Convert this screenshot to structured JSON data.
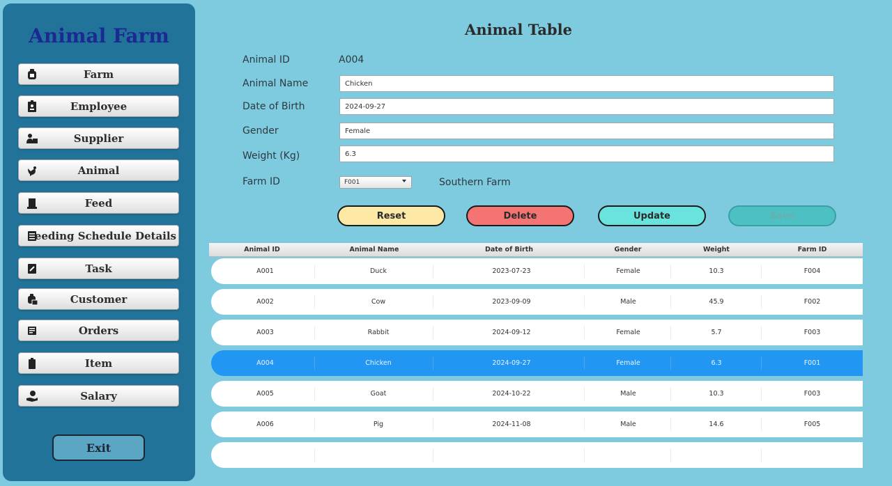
{
  "app": {
    "title": "Animal Farm"
  },
  "sidebar": {
    "items": [
      {
        "label": "Farm",
        "icon": "farm-icon"
      },
      {
        "label": "Employee",
        "icon": "id-badge-icon"
      },
      {
        "label": "Supplier",
        "icon": "supplier-icon"
      },
      {
        "label": "Animal",
        "icon": "chicken-icon"
      },
      {
        "label": "Feed",
        "icon": "feed-sack-icon"
      },
      {
        "label": "Feeding Schedule Details",
        "icon": "list-icon"
      },
      {
        "label": "Task",
        "icon": "task-icon"
      },
      {
        "label": "Customer",
        "icon": "customer-icon"
      },
      {
        "label": "Orders",
        "icon": "orders-icon"
      },
      {
        "label": "Item",
        "icon": "clipboard-icon"
      },
      {
        "label": "Salary",
        "icon": "salary-icon"
      }
    ],
    "exit_label": "Exit"
  },
  "main": {
    "title": "Animal Table",
    "form": {
      "animal_id_label": "Animal ID",
      "animal_id_value": "A004",
      "animal_name_label": "Animal Name",
      "animal_name_value": "Chicken",
      "dob_label": "Date of Birth",
      "dob_value": "2024-09-27",
      "gender_label": "Gender",
      "gender_value": "Female",
      "weight_label": "Weight (Kg)",
      "weight_value": "6.3",
      "farm_id_label": "Farm ID",
      "farm_id_selected": "F001",
      "farm_name": "Southern Farm"
    },
    "buttons": {
      "reset": "Reset",
      "delete": "Delete",
      "update": "Update",
      "save": "Save"
    },
    "colors": {
      "reset": "#fde8a6",
      "delete": "#f47373",
      "update": "#68e3dd",
      "save": "#4cc0c2",
      "selected_row": "#2196f3"
    },
    "table": {
      "headers": [
        "Animal ID",
        "Animal Name",
        "Date of Birth",
        "Gender",
        "Weight",
        "Farm ID"
      ],
      "rows": [
        [
          "A001",
          "Duck",
          "2023-07-23",
          "Female",
          "10.3",
          "F004"
        ],
        [
          "A002",
          "Cow",
          "2023-09-09",
          "Male",
          "45.9",
          "F002"
        ],
        [
          "A003",
          "Rabbit",
          "2024-09-12",
          "Female",
          "5.7",
          "F003"
        ],
        [
          "A004",
          "Chicken",
          "2024-09-27",
          "Female",
          "6.3",
          "F001"
        ],
        [
          "A005",
          "Goat",
          "2024-10-22",
          "Male",
          "10.3",
          "F003"
        ],
        [
          "A006",
          "Pig",
          "2024-11-08",
          "Male",
          "14.6",
          "F005"
        ],
        [
          "",
          "",
          "",
          "",
          "",
          ""
        ]
      ],
      "selected_index": 3
    }
  }
}
